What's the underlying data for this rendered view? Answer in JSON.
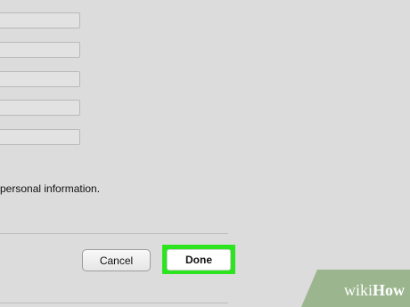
{
  "form": {
    "fields": [
      {
        "value": ""
      },
      {
        "value": ""
      },
      {
        "value": ""
      },
      {
        "value": ""
      },
      {
        "value": ""
      }
    ],
    "info_text": "personal information."
  },
  "buttons": {
    "cancel_label": "Cancel",
    "done_label": "Done"
  },
  "colors": {
    "background": "#dcdcdc",
    "done_highlight": "#2ce51f",
    "watermark_green": "#9bb58e"
  },
  "watermark": {
    "part1": "wiki",
    "part2": "How"
  }
}
